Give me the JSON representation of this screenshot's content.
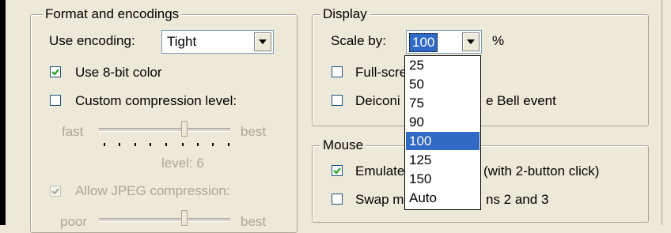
{
  "format_group": {
    "title": "Format and encodings",
    "encoding_label": "Use encoding:",
    "encoding_value": "Tight",
    "use_8bit_label": "Use 8-bit color",
    "use_8bit_checked": true,
    "custom_compression_label": "Custom compression level:",
    "custom_compression_checked": false,
    "compression_min_label": "fast",
    "compression_max_label": "best",
    "compression_level_label": "level: 6",
    "compression_level": 6,
    "allow_jpeg_label": "Allow JPEG compression:",
    "allow_jpeg_checked": true,
    "jpeg_min_label": "poor",
    "jpeg_max_label": "best"
  },
  "display_group": {
    "title": "Display",
    "scale_label": "Scale by:",
    "scale_value": "100",
    "scale_unit": "%",
    "fullscreen_label_visible": "Full-scre",
    "deiconify_label_left": "Deiconi",
    "deiconify_label_right": "e Bell event"
  },
  "mouse_group": {
    "title": "Mouse",
    "emulate_label_left": "Emulate",
    "emulate_label_right": "(with 2-button click)",
    "emulate_checked": true,
    "swap_label_left": "Swap m",
    "swap_label_right": "ns 2 and 3",
    "swap_checked": false
  },
  "scale_dropdown": {
    "options": [
      "25",
      "50",
      "75",
      "90",
      "100",
      "125",
      "150",
      "Auto"
    ],
    "selected": "100"
  },
  "colors": {
    "background": "#ece9d8",
    "selection": "#316ac5",
    "disabled_text": "#aca899"
  }
}
